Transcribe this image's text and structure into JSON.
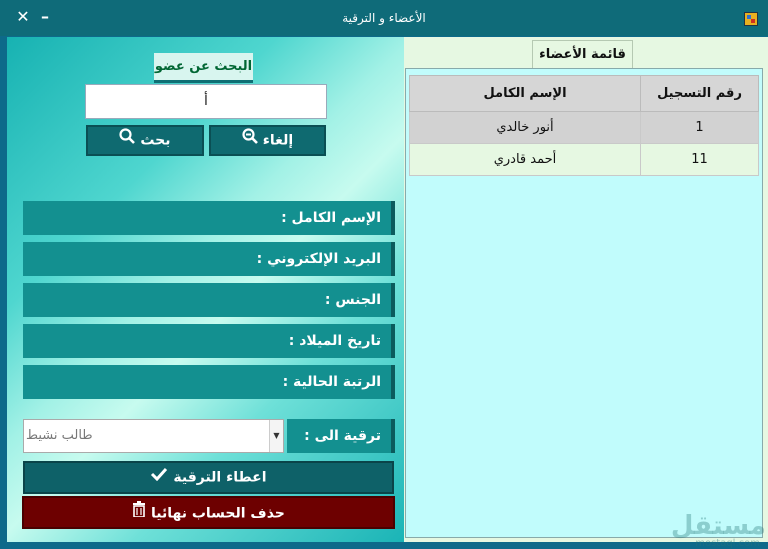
{
  "window": {
    "title": "الأعضاء و الترقية",
    "minimize": "–",
    "close": "✕"
  },
  "search": {
    "tab_label": "البحث عن عضو",
    "input_value": "أ",
    "cancel_label": "إلغاء",
    "search_label": "بحث"
  },
  "fields": {
    "full_name": "الإسم الكامل :",
    "email": "البريد الإلكتروني :",
    "gender": "الجنس :",
    "birth_date": "تاريخ الميلاد :",
    "current_rank": "الرتبة الحالية :"
  },
  "promote": {
    "label": "ترقية الى :",
    "selected": "طالب نشيط"
  },
  "actions": {
    "grant_label": "اعطاء الترقية",
    "delete_label": "حذف الحساب نهائيا"
  },
  "watermark": {
    "main": "مستقل",
    "sub": "mostaql.com"
  },
  "members": {
    "tab_label": "قائمة الأعضاء",
    "columns": [
      "رقم التسجيل",
      "الإسم الكامل"
    ],
    "rows": [
      {
        "id": "1",
        "name": "أنور خالدي"
      },
      {
        "id": "11",
        "name": "أحمد قادري"
      }
    ]
  },
  "colors": {
    "accent": "#0f6a70",
    "danger": "#6d0000",
    "grid_bg": "#c1fcfc"
  },
  "icons": {
    "cancel": "zoom-out-icon",
    "search": "search-icon",
    "grant": "check-icon",
    "delete": "trash-icon"
  }
}
